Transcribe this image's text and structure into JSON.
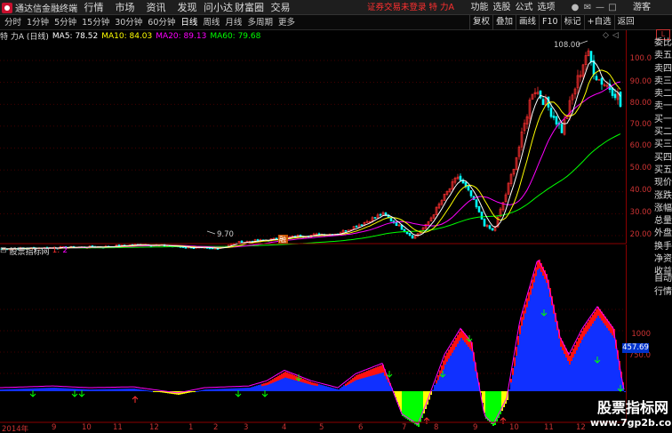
{
  "app": {
    "title": "通达信金融终端"
  },
  "menu": [
    "行情",
    "市场",
    "资讯",
    "发现",
    "问小达",
    "财富圈",
    "交易"
  ],
  "login_status": "证券交易未登录  特 力A",
  "menu_right": [
    "功能",
    "选股",
    "公式",
    "选项"
  ],
  "guest_label": "游客",
  "periods": [
    "分时",
    "1分钟",
    "5分钟",
    "15分钟",
    "30分钟",
    "60分钟",
    "日线",
    "周线",
    "月线",
    "多周期",
    "更多"
  ],
  "active_period": "日线",
  "tools": [
    "复权",
    "叠加",
    "画线",
    "F10",
    "标记",
    "+自选",
    "返回"
  ],
  "stock_title": "特 力A (日线)",
  "ma": [
    {
      "label": "MA5: 78.52",
      "color": "#ffffff"
    },
    {
      "label": "MA10: 84.03",
      "color": "#ffff00"
    },
    {
      "label": "MA20: 89.13",
      "color": "#ff00ff"
    },
    {
      "label": "MA60: 79.68",
      "color": "#00ff00"
    }
  ],
  "high_label": "108.00",
  "low_label": "9.70",
  "event_marker": "融",
  "right_panel": [
    "委比",
    "卖五",
    "卖四",
    "卖三",
    "卖二",
    "卖一",
    "买一",
    "买二",
    "买三",
    "买四",
    "买五",
    "现价",
    "涨跌",
    "涨幅",
    "总量",
    "外盘",
    "换手",
    "净资",
    "收益"
  ],
  "right_panel_bottom": [
    "自动",
    "行情"
  ],
  "y_axis_main": [
    "100.0",
    "90.00",
    "80.00",
    "70.00",
    "60.00",
    "50.00",
    "40.00",
    "30.00",
    "20.00"
  ],
  "y_axis_sub": [
    "1000",
    "750.0"
  ],
  "sub_indicator": {
    "name": "股票指标网",
    "line1": "1:",
    "line2": "2"
  },
  "current_value_tag": "457.69",
  "x_axis": [
    "2014年",
    "9",
    "10",
    "11",
    "12",
    "1",
    "2",
    "3",
    "4",
    "5",
    "6",
    "7",
    "8",
    "9",
    "10",
    "11",
    "12"
  ],
  "watermark": {
    "title": "股票指标网",
    "url": "www.7gp2b.com"
  },
  "colors": {
    "up": "#ff3030",
    "down": "#00ffff",
    "ma5": "#ffffff",
    "ma10": "#ffff00",
    "ma20": "#ff00ff",
    "ma60": "#00ff00",
    "axis": "#cc3333"
  }
}
